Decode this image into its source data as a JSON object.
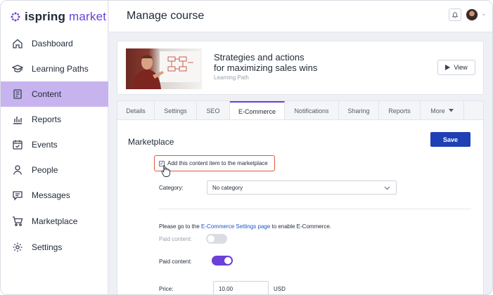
{
  "app": {
    "logo_brand": "ispring",
    "logo_product": "market"
  },
  "sidebar": {
    "items": [
      {
        "label": "Dashboard",
        "icon": "home-icon"
      },
      {
        "label": "Learning Paths",
        "icon": "graduation-cap-icon"
      },
      {
        "label": "Content",
        "icon": "content-icon",
        "active": true
      },
      {
        "label": "Reports",
        "icon": "bar-chart-icon"
      },
      {
        "label": "Events",
        "icon": "calendar-icon"
      },
      {
        "label": "People",
        "icon": "person-icon"
      },
      {
        "label": "Messages",
        "icon": "message-icon"
      },
      {
        "label": "Marketplace",
        "icon": "cart-icon"
      },
      {
        "label": "Settings",
        "icon": "gear-icon"
      }
    ],
    "active_color": "#c7b3ee"
  },
  "header": {
    "title": "Manage course"
  },
  "course": {
    "title_line1": "Strategies and actions",
    "title_line2": "for maximizing sales wins",
    "type": "Learning Path",
    "view_label": "View"
  },
  "tabs": [
    {
      "label": "Details"
    },
    {
      "label": "Settings"
    },
    {
      "label": "SEO"
    },
    {
      "label": "E-Commerce",
      "active": true
    },
    {
      "label": "Notifications"
    },
    {
      "label": "Sharing"
    },
    {
      "label": "Reports"
    },
    {
      "label": "More"
    }
  ],
  "marketplace": {
    "section_title": "Marketplace",
    "save_label": "Save",
    "checkbox_label": "Add this content item to the marketplace",
    "checkbox_checked": true,
    "category_label": "Category:",
    "category_value": "No category",
    "note_prefix": "Please go to the ",
    "note_link": "E-Commerce Settings page",
    "note_suffix": " to enable E-Commerce.",
    "paid_content_disabled_label": "Paid content:",
    "paid_content_disabled_on": false,
    "paid_content_label": "Paid content:",
    "paid_content_on": true,
    "price_label": "Price:",
    "price_value": "10.00",
    "currency": "USD"
  },
  "colors": {
    "accent": "#6b3fd8",
    "save_button": "#1f3fb4",
    "highlight_border": "#e0573f",
    "link": "#1f52c9"
  }
}
